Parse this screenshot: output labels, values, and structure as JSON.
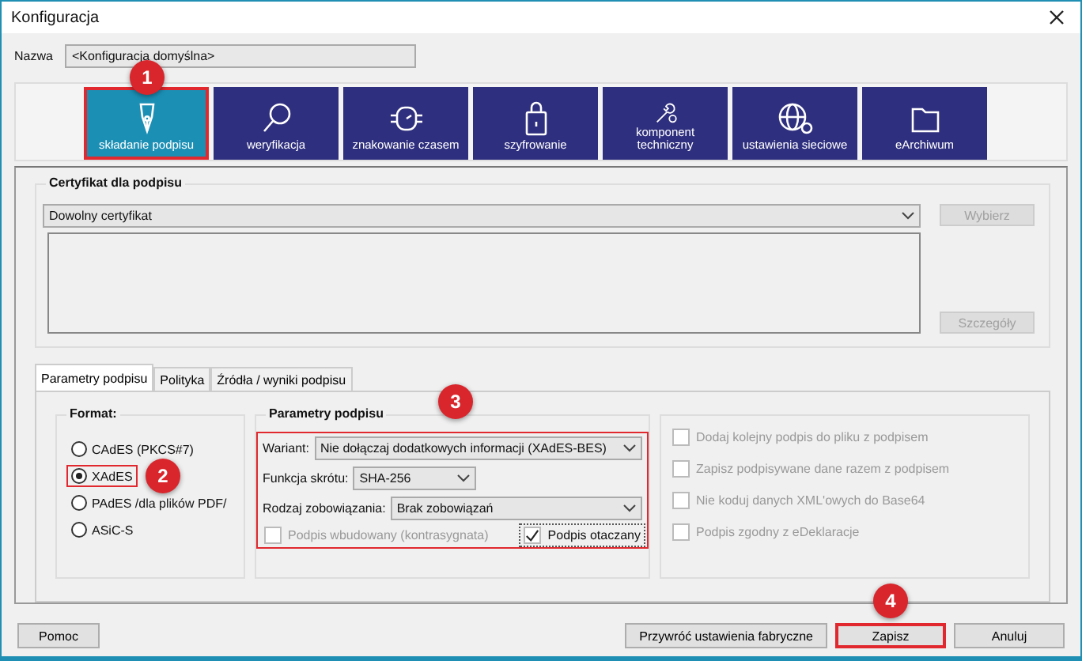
{
  "window": {
    "title": "Konfiguracja"
  },
  "name_field": {
    "label": "Nazwa",
    "value": "<Konfiguracja domyślna>"
  },
  "categories": [
    {
      "label": "składanie podpisu",
      "kind": "pen",
      "selected": true,
      "highlighted": true,
      "badge": "1"
    },
    {
      "label": "weryfikacja",
      "kind": "magnifier",
      "selected": false,
      "highlighted": false
    },
    {
      "label": "znakowanie czasem",
      "kind": "watch",
      "selected": false,
      "highlighted": false
    },
    {
      "label": "szyfrowanie",
      "kind": "lock",
      "selected": false,
      "highlighted": false
    },
    {
      "label": "komponent techniczny",
      "kind": "tools",
      "selected": false,
      "highlighted": false
    },
    {
      "label": "ustawienia sieciowe",
      "kind": "globe",
      "selected": false,
      "highlighted": false
    },
    {
      "label": "eArchiwum",
      "kind": "folder",
      "selected": false,
      "highlighted": false
    }
  ],
  "certificate": {
    "title": "Certyfikat dla podpisu",
    "value": "Dowolny certyfikat",
    "buttons": [
      {
        "label": "Wybierz",
        "disabled": true
      },
      {
        "label": "Szczegóły",
        "disabled": true
      }
    ]
  },
  "tabs": [
    {
      "label": "Parametry podpisu",
      "selected": true
    },
    {
      "label": "Polityka",
      "selected": false
    },
    {
      "label": "Źródła / wyniki podpisu",
      "selected": false
    }
  ],
  "format": {
    "title": "Format:",
    "options": [
      {
        "label": "CAdES (PKCS#7)",
        "selected": false,
        "highlighted": false
      },
      {
        "label": "XAdES",
        "selected": true,
        "highlighted": true,
        "badge": "2"
      },
      {
        "label": "PAdES /dla plików PDF/",
        "selected": false,
        "highlighted": false
      },
      {
        "label": "ASiC-S",
        "selected": false,
        "highlighted": false
      }
    ]
  },
  "parameters": {
    "title": "Parametry podpisu",
    "highlighted": true,
    "badge": "3",
    "fields": [
      {
        "label": "Wariant:",
        "value": "Nie dołączaj dodatkowych informacji (XAdES-BES)",
        "kind": "wide"
      },
      {
        "label": "Funkcja skrótu:",
        "value": "SHA-256",
        "kind": "narrow"
      },
      {
        "label": "Rodzaj zobowiązania:",
        "value": "Brak zobowiązań",
        "kind": "wide"
      }
    ],
    "checkboxes": [
      {
        "label": "Podpis wbudowany (kontrasygnata)",
        "checked": false,
        "disabled": true
      },
      {
        "label": "Podpis otaczany",
        "checked": true,
        "disabled": false
      }
    ]
  },
  "options": [
    {
      "label": "Dodaj kolejny podpis do pliku z podpisem",
      "checked": false,
      "disabled": true
    },
    {
      "label": "Zapisz podpisywane dane razem z podpisem",
      "checked": false,
      "disabled": true
    },
    {
      "label": "Nie koduj danych XML'owych do Base64",
      "checked": false,
      "disabled": true
    },
    {
      "label": "Podpis zgodny z eDeklaracje",
      "checked": false,
      "disabled": true
    }
  ],
  "footer": {
    "help": {
      "label": "Pomoc"
    },
    "buttons": [
      {
        "label": "Przywróć ustawienia fabryczne",
        "highlighted": false
      },
      {
        "label": "Zapisz",
        "highlighted": true,
        "badge": "4"
      },
      {
        "label": "Anuluj",
        "highlighted": false
      }
    ]
  }
}
